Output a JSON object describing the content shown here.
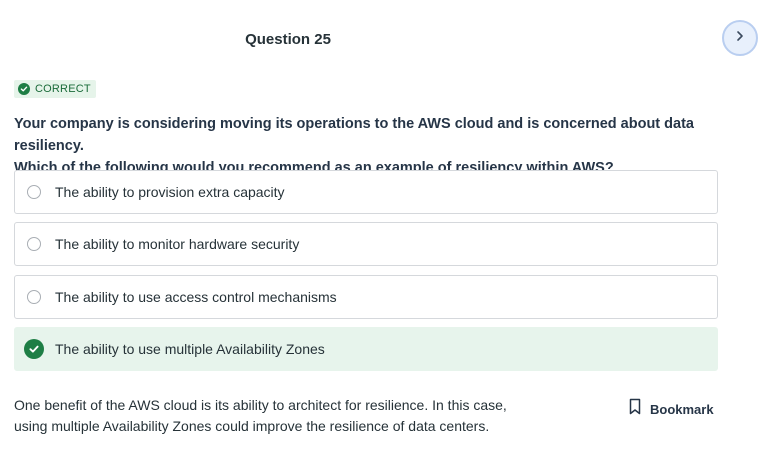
{
  "header": {
    "question_title": "Question 25",
    "next_icon": "chevron-right-icon"
  },
  "result": {
    "badge_label": "CORRECT",
    "badge_color": "#1e7e45"
  },
  "question": {
    "line1": "Your company is considering moving its operations to the AWS cloud and is concerned about data resiliency.",
    "line2": "Which of the following would you recommend as an example of resiliency within AWS?"
  },
  "options": [
    {
      "label": "The ability to provision extra capacity",
      "selected": false
    },
    {
      "label": "The ability to monitor hardware security",
      "selected": false
    },
    {
      "label": "The ability to use access control mechanisms",
      "selected": false
    },
    {
      "label": "The ability to use multiple Availability Zones",
      "selected": true
    }
  ],
  "explanation": {
    "line1": "One benefit of the AWS cloud is its ability to architect for resilience. In this case,",
    "line2": "using multiple Availability Zones could improve the resilience of data centers."
  },
  "bookmark": {
    "label": "Bookmark",
    "icon": "bookmark-icon"
  },
  "colors": {
    "accent_green": "#1e7e45",
    "selected_bg": "#e7f4ec",
    "next_button_bg": "#e8f0fc"
  }
}
